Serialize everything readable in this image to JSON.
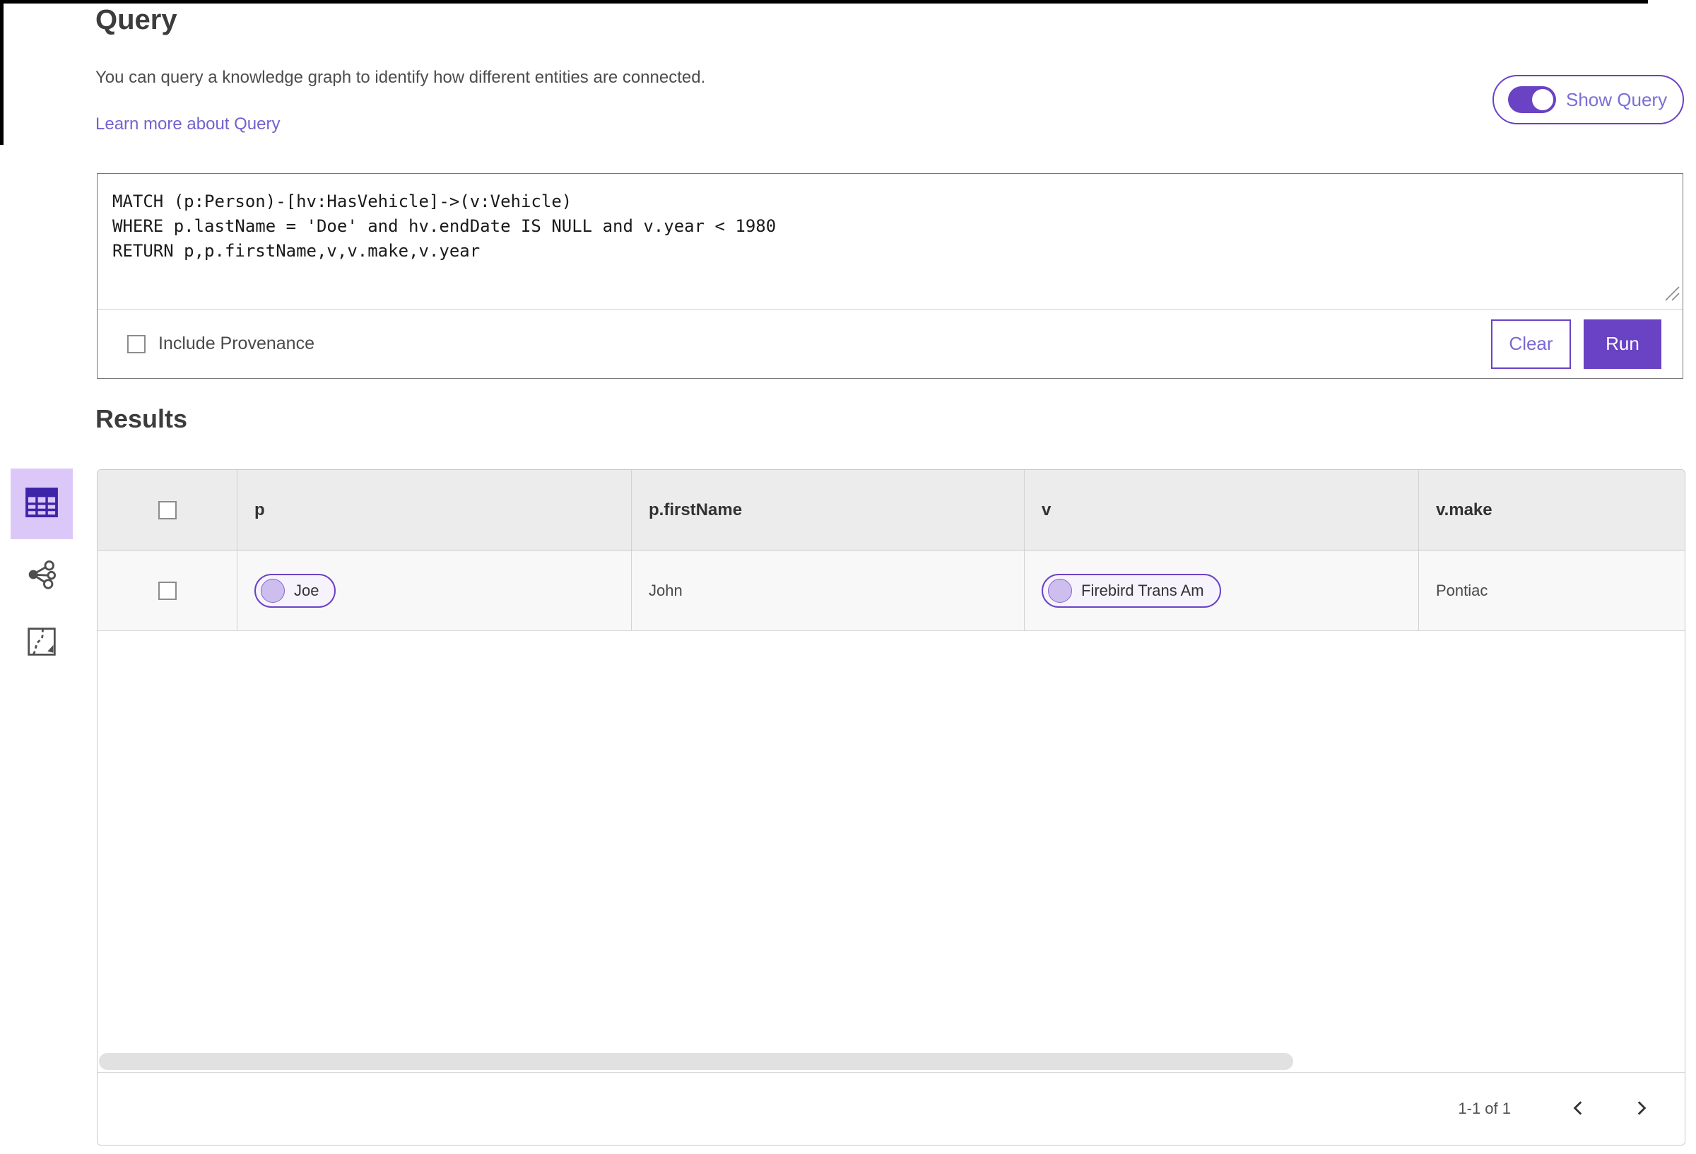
{
  "page": {
    "title": "Query",
    "description": "You can query a knowledge graph to identify how different entities are connected.",
    "learn_more_link": "Learn more about Query",
    "show_query": {
      "label": "Show Query",
      "enabled": true
    }
  },
  "query_editor": {
    "code_lines": [
      "MATCH (p:Person)-[hv:HasVehicle]->(v:Vehicle)",
      "WHERE p.lastName = 'Doe' and hv.endDate IS NULL and v.year < 1980",
      "RETURN p,p.firstName,v,v.make,v.year"
    ],
    "include_provenance": {
      "label": "Include Provenance",
      "checked": false
    },
    "clear_label": "Clear",
    "run_label": "Run"
  },
  "results": {
    "heading": "Results",
    "view_switcher": [
      {
        "name": "table-view",
        "icon": "table-icon",
        "active": true
      },
      {
        "name": "graph-view",
        "icon": "link-chart-icon",
        "active": false
      },
      {
        "name": "map-view",
        "icon": "map-icon",
        "active": false
      }
    ],
    "table": {
      "columns": [
        "p",
        "p.firstName",
        "v",
        "v.make"
      ],
      "rows": [
        {
          "p": "Joe",
          "p_firstName": "John",
          "v": "Firebird Trans Am",
          "v_make": "Pontiac"
        }
      ]
    },
    "pagination": {
      "range_label": "1-1 of 1",
      "prev_icon": "chevron-left",
      "next_icon": "chevron-right"
    }
  },
  "colors": {
    "brand_purple": "#6a42c4",
    "active_view_background": "#dcc8f8",
    "active_icon_purple": "#3e24a8",
    "link_purple": "#7163cf",
    "header_row_background": "#ececec",
    "data_row_background": "#f8f8f8"
  }
}
